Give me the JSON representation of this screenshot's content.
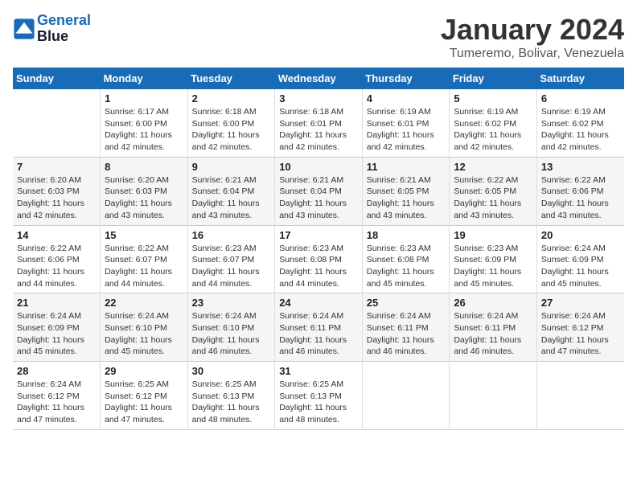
{
  "logo": {
    "line1": "General",
    "line2": "Blue"
  },
  "title": "January 2024",
  "subtitle": "Tumeremo, Bolivar, Venezuela",
  "weekdays": [
    "Sunday",
    "Monday",
    "Tuesday",
    "Wednesday",
    "Thursday",
    "Friday",
    "Saturday"
  ],
  "weeks": [
    [
      {
        "day": "",
        "info": ""
      },
      {
        "day": "1",
        "info": "Sunrise: 6:17 AM\nSunset: 6:00 PM\nDaylight: 11 hours\nand 42 minutes."
      },
      {
        "day": "2",
        "info": "Sunrise: 6:18 AM\nSunset: 6:00 PM\nDaylight: 11 hours\nand 42 minutes."
      },
      {
        "day": "3",
        "info": "Sunrise: 6:18 AM\nSunset: 6:01 PM\nDaylight: 11 hours\nand 42 minutes."
      },
      {
        "day": "4",
        "info": "Sunrise: 6:19 AM\nSunset: 6:01 PM\nDaylight: 11 hours\nand 42 minutes."
      },
      {
        "day": "5",
        "info": "Sunrise: 6:19 AM\nSunset: 6:02 PM\nDaylight: 11 hours\nand 42 minutes."
      },
      {
        "day": "6",
        "info": "Sunrise: 6:19 AM\nSunset: 6:02 PM\nDaylight: 11 hours\nand 42 minutes."
      }
    ],
    [
      {
        "day": "7",
        "info": "Sunrise: 6:20 AM\nSunset: 6:03 PM\nDaylight: 11 hours\nand 42 minutes."
      },
      {
        "day": "8",
        "info": "Sunrise: 6:20 AM\nSunset: 6:03 PM\nDaylight: 11 hours\nand 43 minutes."
      },
      {
        "day": "9",
        "info": "Sunrise: 6:21 AM\nSunset: 6:04 PM\nDaylight: 11 hours\nand 43 minutes."
      },
      {
        "day": "10",
        "info": "Sunrise: 6:21 AM\nSunset: 6:04 PM\nDaylight: 11 hours\nand 43 minutes."
      },
      {
        "day": "11",
        "info": "Sunrise: 6:21 AM\nSunset: 6:05 PM\nDaylight: 11 hours\nand 43 minutes."
      },
      {
        "day": "12",
        "info": "Sunrise: 6:22 AM\nSunset: 6:05 PM\nDaylight: 11 hours\nand 43 minutes."
      },
      {
        "day": "13",
        "info": "Sunrise: 6:22 AM\nSunset: 6:06 PM\nDaylight: 11 hours\nand 43 minutes."
      }
    ],
    [
      {
        "day": "14",
        "info": "Sunrise: 6:22 AM\nSunset: 6:06 PM\nDaylight: 11 hours\nand 44 minutes."
      },
      {
        "day": "15",
        "info": "Sunrise: 6:22 AM\nSunset: 6:07 PM\nDaylight: 11 hours\nand 44 minutes."
      },
      {
        "day": "16",
        "info": "Sunrise: 6:23 AM\nSunset: 6:07 PM\nDaylight: 11 hours\nand 44 minutes."
      },
      {
        "day": "17",
        "info": "Sunrise: 6:23 AM\nSunset: 6:08 PM\nDaylight: 11 hours\nand 44 minutes."
      },
      {
        "day": "18",
        "info": "Sunrise: 6:23 AM\nSunset: 6:08 PM\nDaylight: 11 hours\nand 45 minutes."
      },
      {
        "day": "19",
        "info": "Sunrise: 6:23 AM\nSunset: 6:09 PM\nDaylight: 11 hours\nand 45 minutes."
      },
      {
        "day": "20",
        "info": "Sunrise: 6:24 AM\nSunset: 6:09 PM\nDaylight: 11 hours\nand 45 minutes."
      }
    ],
    [
      {
        "day": "21",
        "info": "Sunrise: 6:24 AM\nSunset: 6:09 PM\nDaylight: 11 hours\nand 45 minutes."
      },
      {
        "day": "22",
        "info": "Sunrise: 6:24 AM\nSunset: 6:10 PM\nDaylight: 11 hours\nand 45 minutes."
      },
      {
        "day": "23",
        "info": "Sunrise: 6:24 AM\nSunset: 6:10 PM\nDaylight: 11 hours\nand 46 minutes."
      },
      {
        "day": "24",
        "info": "Sunrise: 6:24 AM\nSunset: 6:11 PM\nDaylight: 11 hours\nand 46 minutes."
      },
      {
        "day": "25",
        "info": "Sunrise: 6:24 AM\nSunset: 6:11 PM\nDaylight: 11 hours\nand 46 minutes."
      },
      {
        "day": "26",
        "info": "Sunrise: 6:24 AM\nSunset: 6:11 PM\nDaylight: 11 hours\nand 46 minutes."
      },
      {
        "day": "27",
        "info": "Sunrise: 6:24 AM\nSunset: 6:12 PM\nDaylight: 11 hours\nand 47 minutes."
      }
    ],
    [
      {
        "day": "28",
        "info": "Sunrise: 6:24 AM\nSunset: 6:12 PM\nDaylight: 11 hours\nand 47 minutes."
      },
      {
        "day": "29",
        "info": "Sunrise: 6:25 AM\nSunset: 6:12 PM\nDaylight: 11 hours\nand 47 minutes."
      },
      {
        "day": "30",
        "info": "Sunrise: 6:25 AM\nSunset: 6:13 PM\nDaylight: 11 hours\nand 48 minutes."
      },
      {
        "day": "31",
        "info": "Sunrise: 6:25 AM\nSunset: 6:13 PM\nDaylight: 11 hours\nand 48 minutes."
      },
      {
        "day": "",
        "info": ""
      },
      {
        "day": "",
        "info": ""
      },
      {
        "day": "",
        "info": ""
      }
    ]
  ]
}
